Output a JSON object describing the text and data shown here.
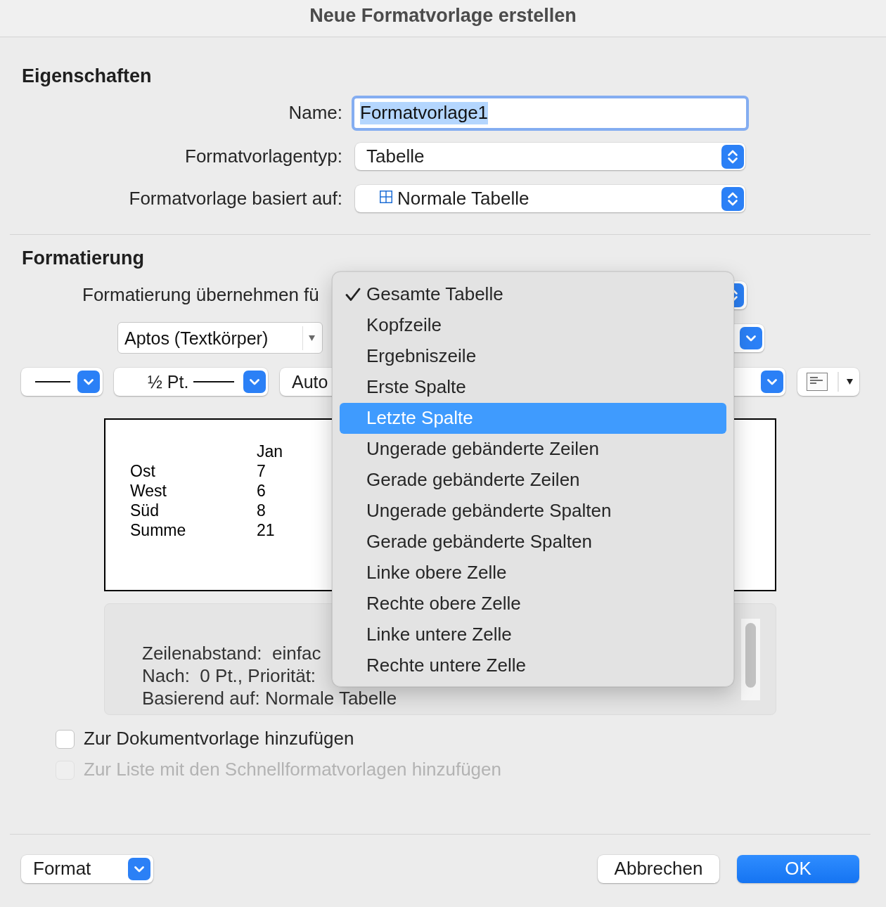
{
  "window": {
    "title": "Neue Formatvorlage erstellen"
  },
  "properties": {
    "heading": "Eigenschaften",
    "fields": [
      {
        "kind": "text",
        "label": "Name:",
        "value": "Formatvorlage1",
        "focused": true,
        "value_selected": true
      },
      {
        "kind": "popup",
        "label": "Formatvorlagentyp:",
        "value": "Tabelle"
      },
      {
        "kind": "table-style-popup",
        "label": "Formatvorlage basiert auf:",
        "value": "Normale Tabelle"
      }
    ]
  },
  "formatting": {
    "heading": "Formatierung",
    "apply_to": {
      "label": "Formatierung übernehmen fü"
    },
    "font_row": [
      {
        "kind": "font-combo",
        "value": "Aptos (Textkörper)"
      },
      {
        "kind": "covered-popup"
      }
    ],
    "border_row": [
      {
        "kind": "line-style"
      },
      {
        "kind": "line-width",
        "value": "½ Pt."
      },
      {
        "kind": "color",
        "value": "Auto"
      },
      {
        "kind": "borders"
      }
    ],
    "preview": {
      "header": "Jan",
      "rows": [
        {
          "label": "Ost",
          "value": "7"
        },
        {
          "label": "West",
          "value": "6"
        },
        {
          "label": "Süd",
          "value": "8"
        },
        {
          "label": "Summe",
          "value": "21"
        }
      ]
    },
    "description": {
      "lines": [
        "Zeilenabstand:  einfac",
        "Nach:  0 Pt., Priorität:",
        "Basierend auf: Normale Tabelle"
      ]
    }
  },
  "checkboxes": [
    {
      "label": "Zur Dokumentvorlage hinzufügen",
      "checked": false,
      "disabled": false
    },
    {
      "label": "Zur Liste mit den Schnellformatvorlagen hinzufügen",
      "checked": false,
      "disabled": true
    }
  ],
  "footer": {
    "format_button": {
      "label": "Format"
    },
    "buttons": [
      {
        "kind": "secondary",
        "label": "Abbrechen"
      },
      {
        "kind": "primary",
        "label": "OK"
      }
    ]
  },
  "apply_menu": {
    "items": [
      {
        "label": "Gesamte Tabelle",
        "selected": true,
        "highlighted": false
      },
      {
        "label": "Kopfzeile",
        "selected": false,
        "highlighted": false
      },
      {
        "label": "Ergebniszeile",
        "selected": false,
        "highlighted": false
      },
      {
        "label": "Erste Spalte",
        "selected": false,
        "highlighted": false
      },
      {
        "label": "Letzte Spalte",
        "selected": false,
        "highlighted": true
      },
      {
        "label": "Ungerade gebänderte Zeilen",
        "selected": false,
        "highlighted": false
      },
      {
        "label": "Gerade gebänderte Zeilen",
        "selected": false,
        "highlighted": false
      },
      {
        "label": "Ungerade gebänderte Spalten",
        "selected": false,
        "highlighted": false
      },
      {
        "label": "Gerade gebänderte Spalten",
        "selected": false,
        "highlighted": false
      },
      {
        "label": "Linke obere Zelle",
        "selected": false,
        "highlighted": false
      },
      {
        "label": "Rechte obere Zelle",
        "selected": false,
        "highlighted": false
      },
      {
        "label": "Linke untere Zelle",
        "selected": false,
        "highlighted": false
      },
      {
        "label": "Rechte untere Zelle",
        "selected": false,
        "highlighted": false
      }
    ]
  }
}
